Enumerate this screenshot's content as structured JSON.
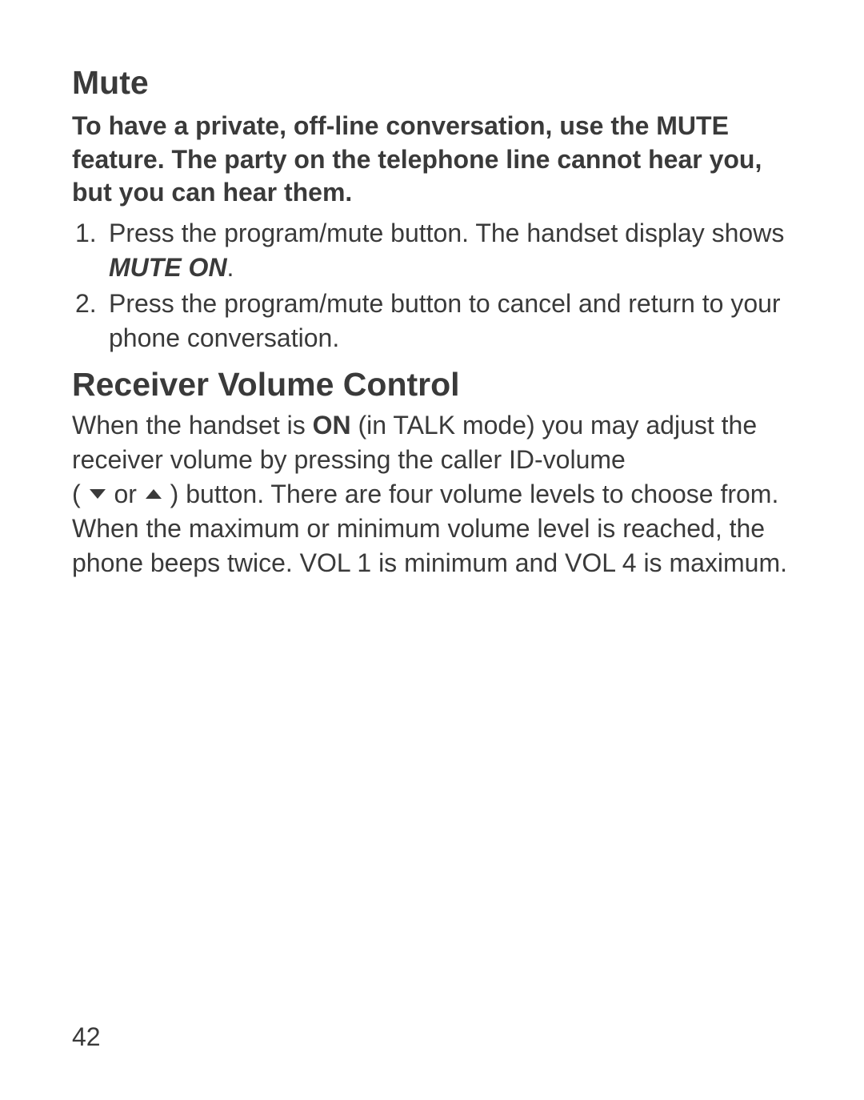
{
  "sections": {
    "mute": {
      "heading": "Mute",
      "intro": "To have a private, off-line conversation, use the MUTE feature. The party on the telephone line cannot hear you, but you can hear them.",
      "steps": [
        {
          "prefix": "Press the program/mute button. The handset display shows ",
          "emphasis": "MUTE ON",
          "suffix": "."
        },
        {
          "prefix": "Press the program/mute button to cancel and return to your phone conversation.",
          "emphasis": "",
          "suffix": ""
        }
      ]
    },
    "volume": {
      "heading": "Receiver Volume Control",
      "body": {
        "part1": "When the handset is ",
        "bold1": "ON",
        "part2": " (in TALK mode) you may adjust the receiver volume by pressing the caller ID-volume",
        "part3": "( ",
        "or": " or ",
        "part4": " ) button. There are four volume levels to choose from. When the maximum or minimum volume level is reached, the phone beeps twice. VOL 1 is minimum and VOL 4 is maximum."
      }
    }
  },
  "pageNumber": "42"
}
